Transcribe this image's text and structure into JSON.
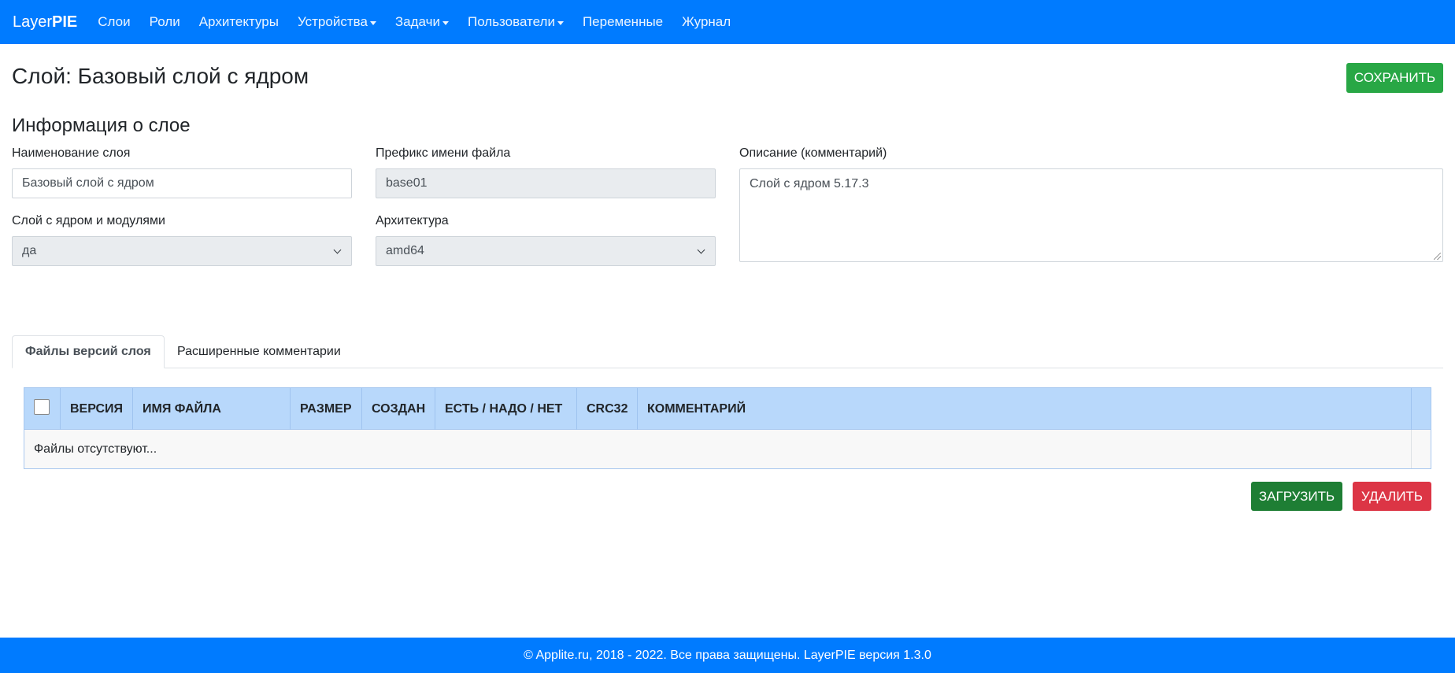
{
  "navbar": {
    "brand_light": "Layer",
    "brand_bold": "PIE",
    "items": [
      {
        "label": "Слои"
      },
      {
        "label": "Роли"
      },
      {
        "label": "Архитектуры"
      },
      {
        "label": "Устройства"
      },
      {
        "label": "Задачи"
      },
      {
        "label": "Пользователи"
      },
      {
        "label": "Переменные"
      },
      {
        "label": "Журнал"
      }
    ]
  },
  "page": {
    "title": "Слой: Базовый слой с ядром",
    "save_label": "Сохранить"
  },
  "info": {
    "section_title": "Информация о слое",
    "name_label": "Наименование слоя",
    "name_value": "Базовый слой с ядром",
    "prefix_label": "Префикс имени файла",
    "prefix_value": "base01",
    "description_label": "Описание (комментарий)",
    "description_value": "Слой с ядром 5.17.3",
    "kernel_label": "Слой с ядром и модулями",
    "kernel_value": "да",
    "arch_label": "Архитектура",
    "arch_value": "amd64"
  },
  "tabs": [
    {
      "label": "Файлы версий слоя",
      "active": true
    },
    {
      "label": "Расширенные комментарии",
      "active": false
    }
  ],
  "table": {
    "columns": [
      "Версия",
      "Имя файла",
      "Размер",
      "Создан",
      "Есть / Надо / Нет",
      "CRC32",
      "Комментарий"
    ],
    "empty_text": "Файлы отсутствуют..."
  },
  "actions": {
    "upload_label": "Загрузить",
    "delete_label": "Удалить"
  },
  "footer": {
    "text": "© Applite.ru, 2018 - 2022. Все права защищены. LayerPIE версия 1.3.0"
  },
  "colors": {
    "primary": "#007bff",
    "success": "#28a745",
    "danger": "#dc3545",
    "table_header": "#b8d8fb"
  }
}
